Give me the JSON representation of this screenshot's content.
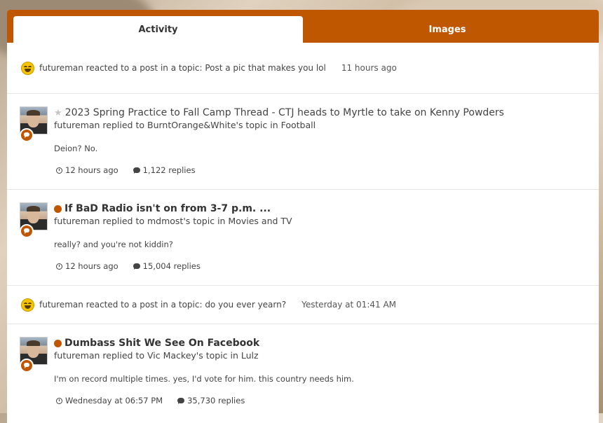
{
  "tabs": [
    {
      "label": "Activity",
      "active": true
    },
    {
      "label": "Images",
      "active": false
    }
  ],
  "colors": {
    "accent": "#bf5700",
    "text": "#444444",
    "divider": "#e6e6e6"
  },
  "feed": [
    {
      "type": "reaction",
      "icon": "laughing-emoji-icon",
      "text": "futureman reacted to a post in a topic: Post a pic that makes you lol",
      "time": "11 hours ago"
    },
    {
      "type": "reply",
      "marker": "star-icon",
      "title": "2023 Spring Practice to Fall Camp Thread - CTJ heads to Myrtle to take on Kenny Powders",
      "subtitle": "futureman replied to BurntOrange&White's topic in Football",
      "excerpt": "Deion? No.",
      "time": "12 hours ago",
      "replies": "1,122 replies"
    },
    {
      "type": "reply",
      "marker": "unread-dot-icon",
      "title": "If BaD Radio isn't on from 3-7 p.m. ...",
      "subtitle": "futureman replied to mdmost's topic in Movies and TV",
      "excerpt": "really? and you're not kiddin?",
      "time": "12 hours ago",
      "replies": "15,004 replies"
    },
    {
      "type": "reaction",
      "icon": "laughing-emoji-icon",
      "text": "futureman reacted to a post in a topic: do you ever yearn?",
      "time": "Yesterday at 01:41 AM"
    },
    {
      "type": "reply",
      "marker": "unread-dot-icon",
      "title": "Dumbass Shit We See On Facebook",
      "subtitle": "futureman replied to Vic Mackey's topic in Lulz",
      "excerpt": "I'm on record multiple times. yes, I'd vote for him. this country needs him.",
      "time": "Wednesday at 06:57 PM",
      "replies": "35,730 replies"
    }
  ]
}
